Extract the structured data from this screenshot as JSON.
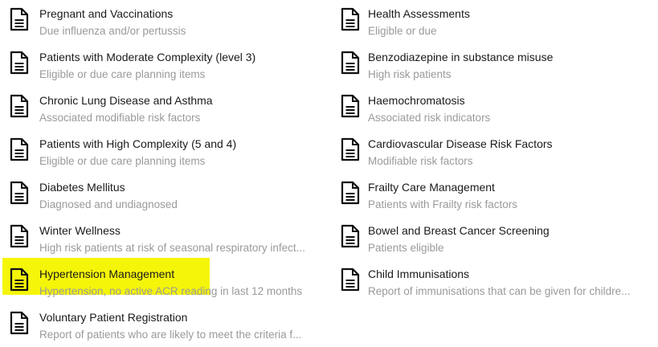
{
  "highlight_color": "#f5f50a",
  "left_column": [
    {
      "title": "Pregnant and Vaccinations",
      "subtitle": "Due  influenza  and/or pertussis",
      "icon": "document-icon"
    },
    {
      "title": "Patients with Moderate Complexity (level 3)",
      "subtitle": "Eligible or due care planning items",
      "icon": "document-icon"
    },
    {
      "title": "Chronic Lung Disease and Asthma",
      "subtitle": "Associated modifiable risk factors",
      "icon": "document-icon"
    },
    {
      "title": "Patients with High Complexity (5 and 4)",
      "subtitle": "Eligible or due care planning items",
      "icon": "document-icon"
    },
    {
      "title": "Diabetes Mellitus",
      "subtitle": "Diagnosed and undiagnosed",
      "icon": "document-icon"
    },
    {
      "title": "Winter Wellness",
      "subtitle": "High risk patients at risk of seasonal respiratory infect...",
      "icon": "document-icon"
    },
    {
      "title": "Hypertension Management",
      "subtitle": "Hypertension, no active ACR reading in last 12 months",
      "icon": "document-icon",
      "highlighted": true
    },
    {
      "title": "Voluntary Patient Registration",
      "subtitle": "Report of patients who are likely to meet the criteria f...",
      "icon": "document-icon"
    }
  ],
  "right_column": [
    {
      "title": "Health Assessments",
      "subtitle": "Eligible or due",
      "icon": "document-icon"
    },
    {
      "title": "Benzodiazepine in substance misuse",
      "subtitle": "High risk patients",
      "icon": "document-icon"
    },
    {
      "title": "Haemochromatosis",
      "subtitle": "Associated risk indicators",
      "icon": "document-icon"
    },
    {
      "title": "Cardiovascular Disease Risk Factors",
      "subtitle": "Modifiable risk factors",
      "icon": "document-icon"
    },
    {
      "title": "Frailty Care Management",
      "subtitle": "Patients with Frailty risk factors",
      "icon": "document-icon"
    },
    {
      "title": "Bowel and Breast Cancer Screening",
      "subtitle": "Patients eligible",
      "icon": "document-icon"
    },
    {
      "title": "Child Immunisations",
      "subtitle": "Report of immunisations that can be given for childre...",
      "icon": "document-icon"
    }
  ]
}
